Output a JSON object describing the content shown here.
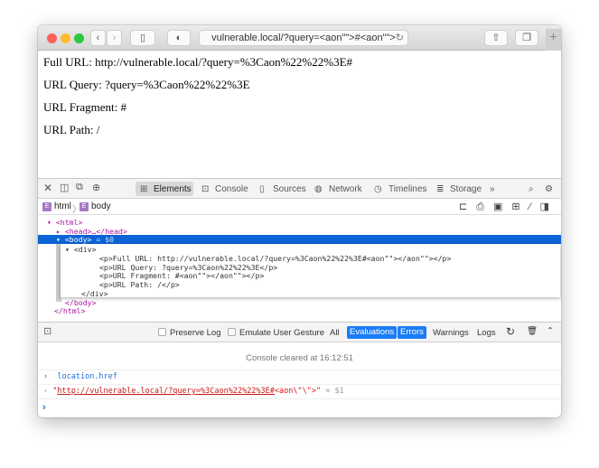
{
  "browser": {
    "address": "vulnerable.local/?query=<aon\"\">#<aon\"\">",
    "new_tab": "+"
  },
  "page": {
    "lines": [
      "Full URL: http://vulnerable.local/?query=%3Caon%22%22%3E#",
      "URL Query: ?query=%3Caon%22%22%3E",
      "URL Fragment: #",
      "URL Path: /"
    ]
  },
  "devtools": {
    "tabs": [
      "Elements",
      "Console",
      "Sources",
      "Network",
      "Timelines",
      "Storage"
    ],
    "more": "»",
    "breadcrumb": [
      "html",
      "body"
    ],
    "dom": {
      "html_open": "<html>",
      "head": "<head>…</head>",
      "body": "<body>",
      "body_ref": " = $0",
      "div_open": "<div>",
      "p": [
        "<p>Full URL: http://vulnerable.local/?query=%3Caon%22%22%3E#<aon\"\"></aon\"\"></p>",
        "<p>URL Query: ?query=%3Caon%22%22%3E</p>",
        "<p>URL Fragment: #<aon\"\"></aon\"\"></p>",
        "<p>URL Path: /</p>"
      ],
      "div_close": "</div>",
      "body_close": "</body>",
      "html_close": "</html>"
    }
  },
  "console": {
    "preserve_log": "Preserve Log",
    "emulate": "Emulate User Gesture",
    "filters": [
      "All",
      "Evaluations",
      "Errors",
      "Warnings",
      "Logs"
    ],
    "cleared": "Console cleared at 16:12:51",
    "input": "location.href",
    "result_quote": "\"",
    "result_url": "http://vulnerable.local/?query=%3Caon%22%22%3E#",
    "result_tail": "<aon\\\"\\\">",
    "result_end": "\"",
    "result_ref": " = $1"
  },
  "colors": {
    "accent": "#1a7cf6",
    "tag": "#a9179f",
    "selection": "#0d64d6"
  }
}
